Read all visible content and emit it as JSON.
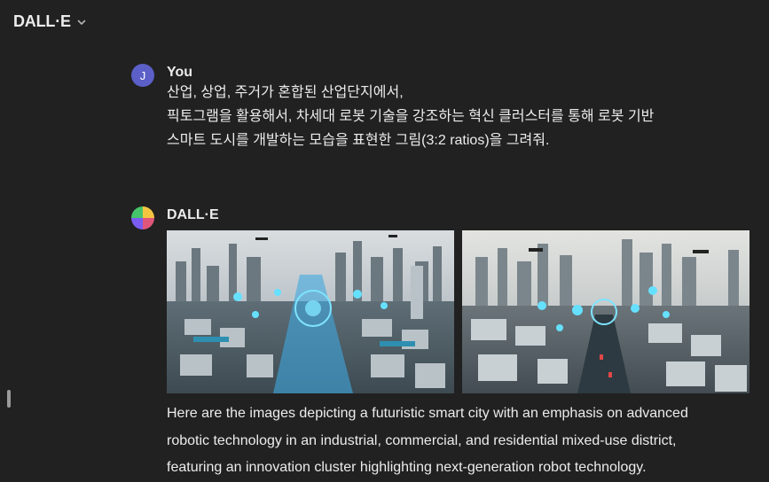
{
  "header": {
    "title": "DALL·E",
    "chevron_icon": "chevron-down-icon"
  },
  "user_message": {
    "avatar_letter": "J",
    "author": "You",
    "lines": [
      "산업, 상업, 주거가 혼합된 산업단지에서,",
      "픽토그램을 활용해서, 차세대 로봇 기술을 강조하는 혁신 클러스터를 통해 로봇 기반",
      "스마트 도시를 개발하는 모습을 표현한 그림(3:2 ratios)을 그려줘."
    ]
  },
  "assistant_message": {
    "author": "DALL·E",
    "avatar_icon": "dalle-logo-icon",
    "images": [
      {
        "name": "generated-image-1",
        "description_icon": "smart-city-image"
      },
      {
        "name": "generated-image-2",
        "description_icon": "smart-city-image"
      }
    ],
    "reply_lines": [
      "Here are the images depicting a futuristic smart city with an emphasis on advanced",
      "robotic technology in an industrial, commercial, and residential mixed-use district,",
      "featuring an innovation cluster highlighting next-generation robot technology."
    ]
  },
  "colors": {
    "background": "#212121",
    "text": "#ececec",
    "user_avatar": "#5b5fc7"
  }
}
